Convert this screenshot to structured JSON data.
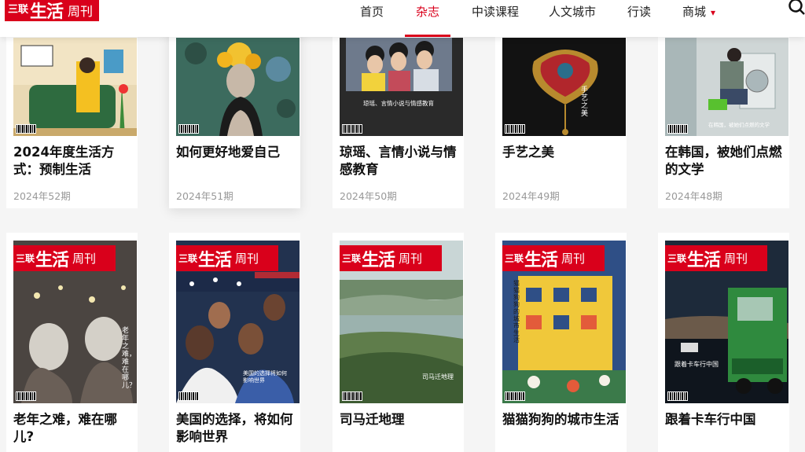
{
  "header": {
    "logo": {
      "l1": "三联",
      "l2": "生活",
      "l3": "周刊"
    },
    "nav": [
      {
        "label": "首页"
      },
      {
        "label": "杂志"
      },
      {
        "label": "中读课程"
      },
      {
        "label": "人文城市"
      },
      {
        "label": "行读"
      },
      {
        "label": "商城"
      }
    ]
  },
  "magazines": [
    {
      "title": "2024年度生活方式：预制生活",
      "issue": "2024年52期"
    },
    {
      "title": "如何更好地爱自己",
      "issue": "2024年51期"
    },
    {
      "title": "琼瑶、言情小说与情感教育",
      "issue": "2024年50期",
      "cover_text": "琼瑶、言情小说与情感教育"
    },
    {
      "title": "手艺之美",
      "issue": "2024年49期",
      "cover_text": "手艺之美"
    },
    {
      "title": "在韩国，被她们点燃的文学",
      "issue": "2024年48期",
      "cover_text": "在韩国，被她们点燃的文学"
    },
    {
      "title": "老年之难，难在哪儿?",
      "cover_text": "老年之难，难在哪儿？"
    },
    {
      "title": "美国的选择，将如何影响世界",
      "cover_text": "美国的选择将如何影响世界"
    },
    {
      "title": "司马迁地理",
      "cover_text": "司马迁地理"
    },
    {
      "title": "猫猫狗狗的城市生活",
      "cover_text": "猫猫狗狗的城市生活"
    },
    {
      "title": "跟着卡车行中国",
      "cover_text": "跟着卡车行中国"
    }
  ],
  "masthead": {
    "m1": "三联",
    "m2": "生活",
    "m3": "周刊"
  },
  "colors": {
    "brand": "#d9001b",
    "issue_text": "#999999"
  }
}
